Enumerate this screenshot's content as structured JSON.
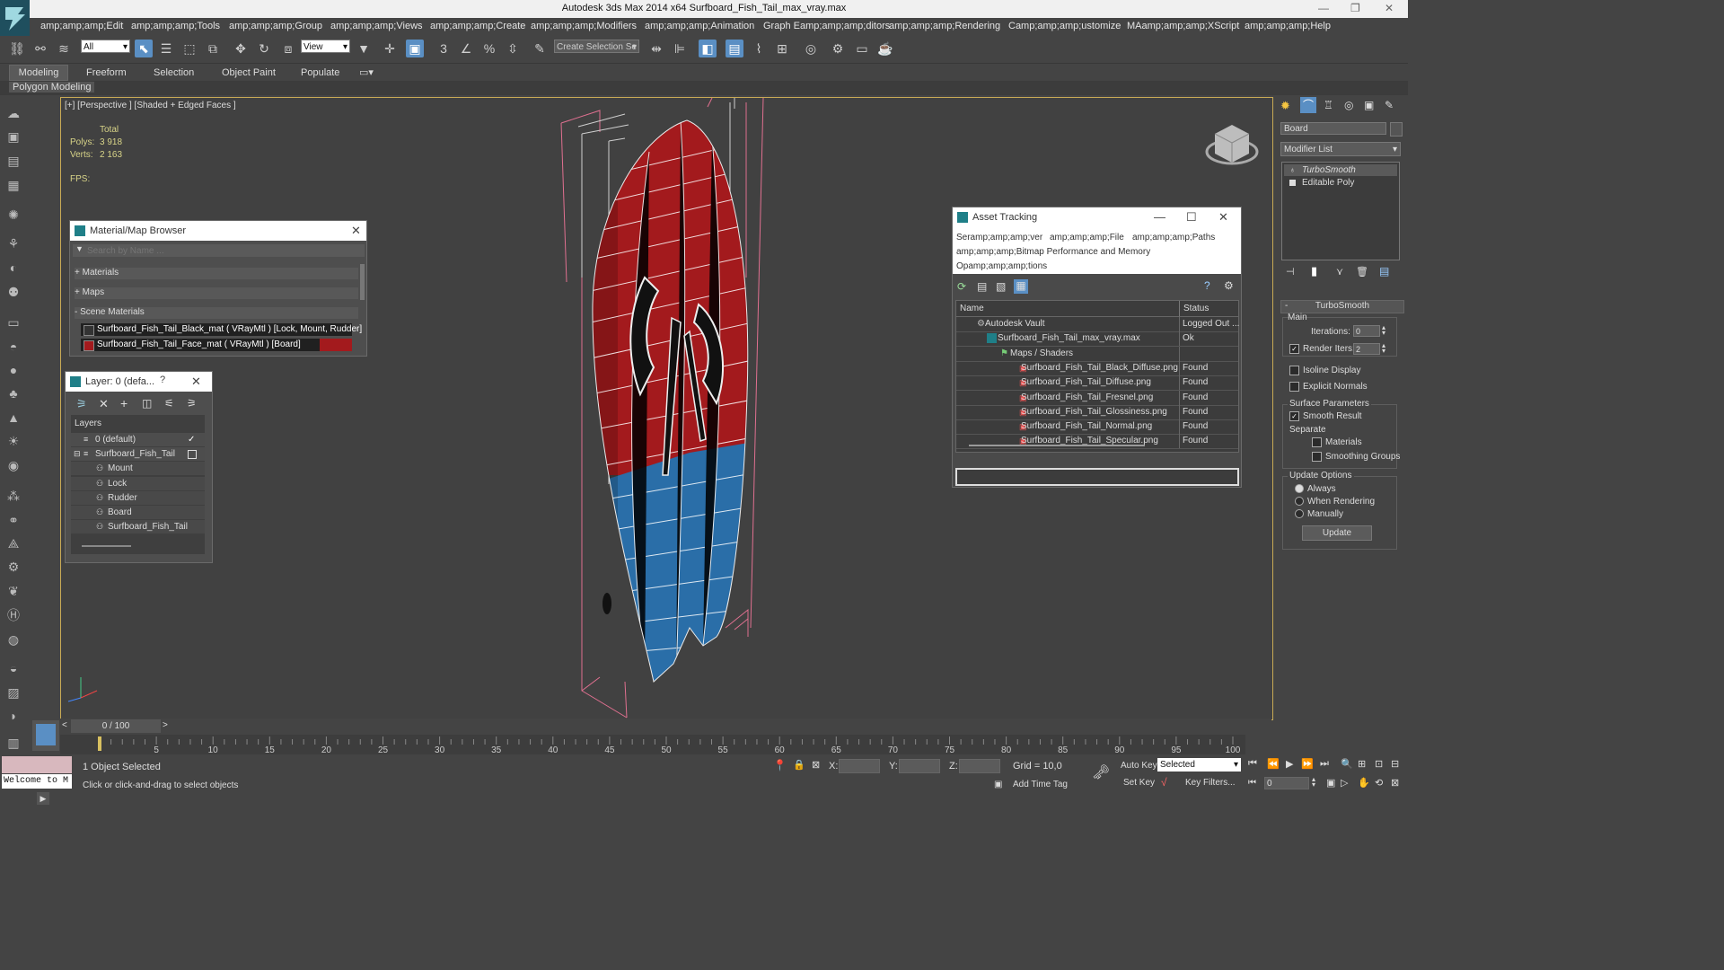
{
  "window": {
    "title": "Autodesk 3ds Max  2014 x64     Surfboard_Fish_Tail_max_vray.max"
  },
  "menu": [
    "amp;amp;amp;Edit",
    "amp;amp;amp;Tools",
    "amp;amp;amp;Group",
    "amp;amp;amp;Views",
    "amp;amp;amp;Create",
    "amp;amp;amp;Modifiers",
    "amp;amp;amp;Animation",
    "Graph Eamp;amp;amp;ditors",
    "amp;amp;amp;Rendering",
    "Camp;amp;amp;ustomize",
    "MAamp;amp;amp;XScript",
    "amp;amp;amp;Help"
  ],
  "toolbar": {
    "filter_value": "All",
    "refcoord_value": "View",
    "selection_set_placeholder": "Create Selection Se"
  },
  "ribbon": {
    "tabs": [
      "Modeling",
      "Freeform",
      "Selection",
      "Object Paint",
      "Populate"
    ],
    "subtitle": "Polygon Modeling"
  },
  "viewport": {
    "label": "[+] [Perspective ] [Shaded + Edged Faces ]",
    "stats": {
      "total": "Total",
      "polys_label": "Polys:",
      "polys": "3 918",
      "verts_label": "Verts:",
      "verts": "2 163",
      "fps_label": "FPS:"
    }
  },
  "material_browser": {
    "title": "Material/Map Browser",
    "search_placeholder": "Search by Name ...",
    "groups": [
      "+ Materials",
      "+ Maps",
      "- Scene Materials"
    ],
    "items": [
      "Surfboard_Fish_Tail_Black_mat  ( VRayMtl )  [Lock, Mount, Rudder]",
      "Surfboard_Fish_Tail_Face_mat  ( VRayMtl )  [Board]"
    ]
  },
  "layer_panel": {
    "title": "Layer: 0 (defa...",
    "help": "?",
    "header": "Layers",
    "items": [
      {
        "name": "0 (default)",
        "indent": 0
      },
      {
        "name": "Surfboard_Fish_Tail",
        "indent": 0
      },
      {
        "name": "Mount",
        "indent": 1
      },
      {
        "name": "Lock",
        "indent": 1
      },
      {
        "name": "Rudder",
        "indent": 1
      },
      {
        "name": "Board",
        "indent": 1
      },
      {
        "name": "Surfboard_Fish_Tail",
        "indent": 1
      }
    ]
  },
  "asset_tracking": {
    "title": "Asset Tracking",
    "menu_row1": [
      "Seramp;amp;amp;ver",
      "amp;amp;amp;File",
      "amp;amp;amp;Paths"
    ],
    "menu_row2": "amp;amp;amp;Bitmap Performance and Memory",
    "menu_row3": "Opamp;amp;amp;tions",
    "columns": [
      "Name",
      "Status"
    ],
    "rows": [
      {
        "name": "Autodesk Vault",
        "status": "Logged Out ...",
        "indent": 1
      },
      {
        "name": "Surfboard_Fish_Tail_max_vray.max",
        "status": "Ok",
        "indent": 2
      },
      {
        "name": "Maps / Shaders",
        "status": "",
        "indent": 3
      },
      {
        "name": "Surfboard_Fish_Tail_Black_Diffuse.png",
        "status": "Found",
        "indent": 4
      },
      {
        "name": "Surfboard_Fish_Tail_Diffuse.png",
        "status": "Found",
        "indent": 4
      },
      {
        "name": "Surfboard_Fish_Tail_Fresnel.png",
        "status": "Found",
        "indent": 4
      },
      {
        "name": "Surfboard_Fish_Tail_Glossiness.png",
        "status": "Found",
        "indent": 4
      },
      {
        "name": "Surfboard_Fish_Tail_Normal.png",
        "status": "Found",
        "indent": 4
      },
      {
        "name": "Surfboard_Fish_Tail_Specular.png",
        "status": "Found",
        "indent": 4
      }
    ]
  },
  "command_panel": {
    "object_name": "Board",
    "modifier_list": "Modifier List",
    "stack": [
      "TurboSmooth",
      "Editable Poly"
    ],
    "rollout_title": "TurboSmooth",
    "main_label": "Main",
    "iterations_label": "Iterations:",
    "iterations": "0",
    "render_iters_label": "Render Iters:",
    "render_iters": "2",
    "isoline": "Isoline Display",
    "explicit": "Explicit Normals",
    "surface_params": "Surface Parameters",
    "smooth_result": "Smooth Result",
    "separate": "Separate",
    "materials": "Materials",
    "smoothing_groups": "Smoothing Groups",
    "update_options": "Update Options",
    "always": "Always",
    "when_rendering": "When Rendering",
    "manually": "Manually",
    "update_button": "Update"
  },
  "timeline": {
    "frame": "0 / 100",
    "ticks": [
      "5",
      "10",
      "15",
      "20",
      "25",
      "30",
      "35",
      "40",
      "45",
      "50",
      "55",
      "60",
      "65",
      "70",
      "75",
      "80",
      "85",
      "90",
      "95",
      "100"
    ]
  },
  "status": {
    "welcome": "Welcome to M",
    "selected": "1 Object Selected",
    "prompt": "Click or click-and-drag to select objects",
    "x_label": "X:",
    "y_label": "Y:",
    "z_label": "Z:",
    "grid": "Grid = 10,0",
    "add_time_tag": "Add Time Tag",
    "auto_key": "Auto Key",
    "set_key": "Set Key",
    "selected_dropdown": "Selected",
    "key_filters": "Key Filters...",
    "frame_field": "0"
  },
  "colors": {
    "board_top": "#a31a1d",
    "board_bottom": "#2a6ea8",
    "bbox": "#e07090",
    "accent": "#5a8fc4"
  }
}
